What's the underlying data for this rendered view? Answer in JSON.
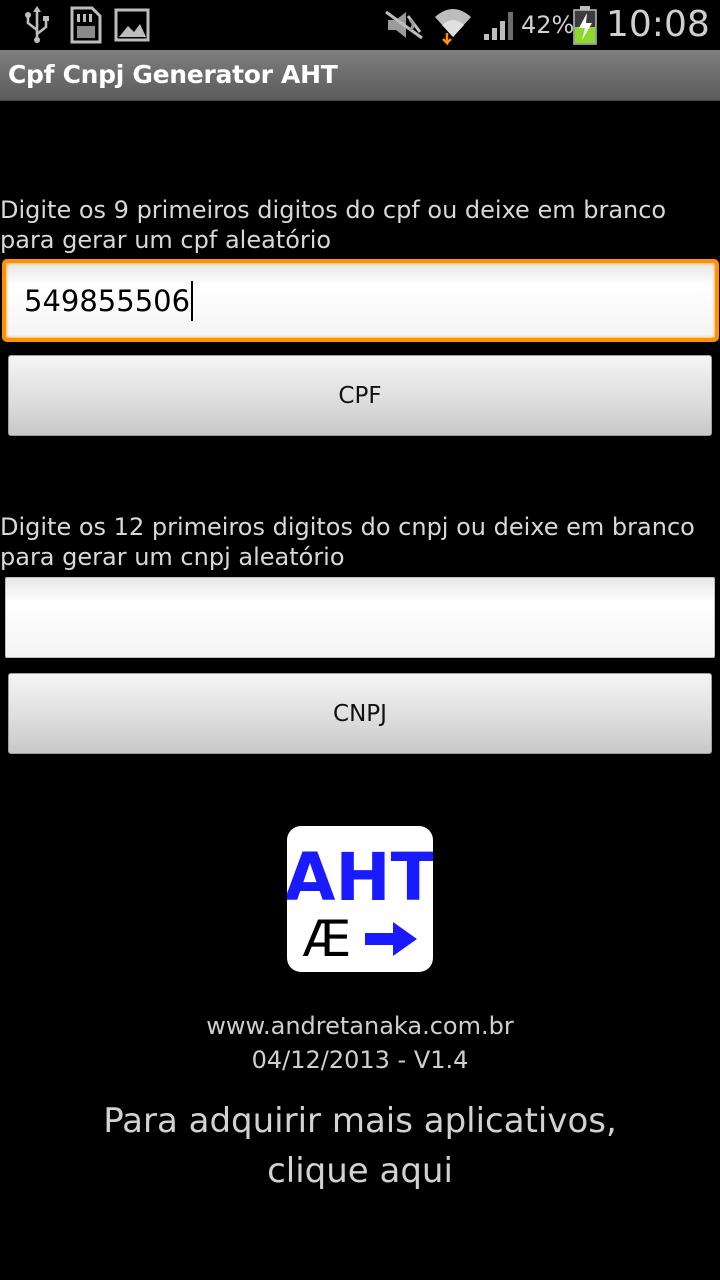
{
  "status_bar": {
    "battery_percent": "42%",
    "time": "10:08",
    "icons": [
      "usb-icon",
      "sd-card-icon",
      "image-icon",
      "mute-icon",
      "wifi-icon",
      "signal-icon",
      "battery-charging-icon"
    ]
  },
  "app": {
    "title": "Cpf Cnpj Generator AHT"
  },
  "cpf": {
    "prompt": "Digite os 9 primeiros digitos do cpf ou deixe em branco para gerar um cpf aleatório",
    "value": "549855506",
    "button_label": "CPF"
  },
  "cnpj": {
    "prompt": "Digite os 12 primeiros digitos do cnpj ou deixe em branco para gerar um cnpj aleatório",
    "value": "",
    "button_label": "CNPJ"
  },
  "logo": {
    "text_top": "AHT",
    "text_bottom": "Æ"
  },
  "footer": {
    "website": "www.andretanaka.com.br",
    "version": "04/12/2013 - V1.4",
    "more_apps_line1": "Para adquirir mais aplicativos,",
    "more_apps_line2": "clique aqui"
  },
  "colors": {
    "focus_accent": "#ff9100",
    "logo_blue": "#1a1aff"
  }
}
